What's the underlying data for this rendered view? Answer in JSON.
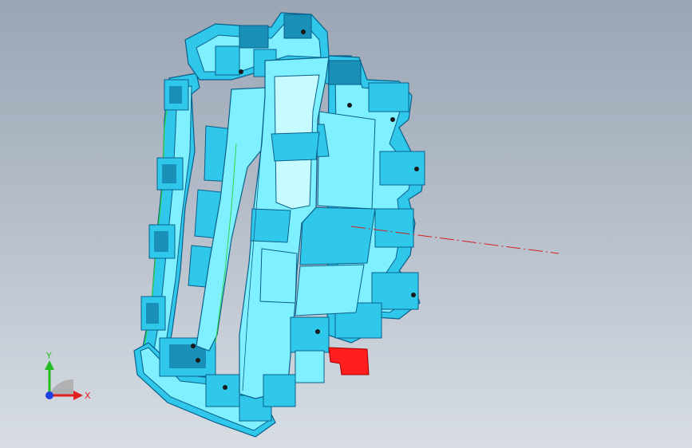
{
  "viewport": {
    "background_top": "#9ba5b4",
    "background_bottom": "#d8dde4"
  },
  "model": {
    "body_color": "#7ff0ff",
    "shade_color": "#2fc8ea",
    "dark_color": "#1a8fb8",
    "edge_color": "#0b5f8a",
    "highlight_color": "#c6fbff",
    "selected_face_color": "#ff1d1d",
    "axis_line_color": "#d42020",
    "green_edge_color": "#2fd44c"
  },
  "triad": {
    "x_label": "X",
    "y_label": "Y",
    "x_color": "#e02020",
    "y_color": "#22bb22",
    "z_color": "#1f3fe0",
    "icon": "coordinate-triad-icon"
  }
}
